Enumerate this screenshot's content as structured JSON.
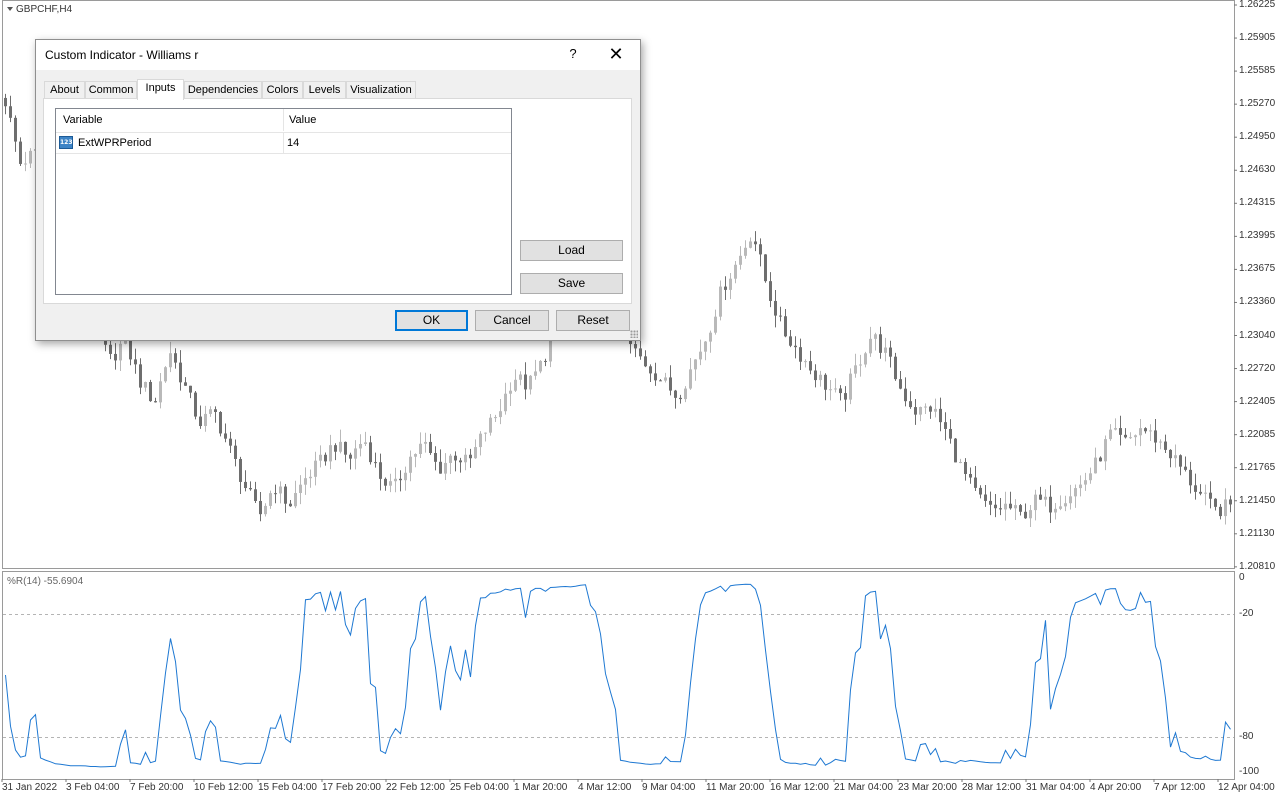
{
  "chart": {
    "symbol": "GBPCHF,H4",
    "indicator_label": "%R(14) -55.6904",
    "price_axis": [
      "1.26225",
      "1.25905",
      "1.25585",
      "1.25270",
      "1.24950",
      "1.24630",
      "1.24315",
      "1.23995",
      "1.23675",
      "1.23360",
      "1.23040",
      "1.22720",
      "1.22405",
      "1.22085",
      "1.21765",
      "1.21450",
      "1.21130",
      "1.20810"
    ],
    "indicator_axis": [
      "0",
      "-20",
      "-80",
      "-100"
    ],
    "time_axis": [
      "31 Jan 2022",
      "3 Feb 04:00",
      "7 Feb 20:00",
      "10 Feb 12:00",
      "15 Feb 04:00",
      "17 Feb 20:00",
      "22 Feb 12:00",
      "25 Feb 04:00",
      "1 Mar 20:00",
      "4 Mar 12:00",
      "9 Mar 04:00",
      "11 Mar 20:00",
      "16 Mar 12:00",
      "21 Mar 04:00",
      "23 Mar 20:00",
      "28 Mar 12:00",
      "31 Mar 04:00",
      "4 Apr 20:00",
      "7 Apr 12:00",
      "12 Apr 04:00"
    ],
    "colors": {
      "bull_candle": "#b9b9b9",
      "bear_candle": "#6e6e6e",
      "indicator_line": "#1e78d2",
      "level_line": "#b4b4b4"
    },
    "price_path": [
      1.253,
      1.247,
      1.248,
      1.244,
      1.2395,
      1.235,
      1.231,
      1.228,
      1.23,
      1.226,
      1.224,
      1.229,
      1.2255,
      1.222,
      1.223,
      1.2195,
      1.216,
      1.213,
      1.216,
      1.214,
      1.2165,
      1.218,
      1.22,
      1.2185,
      1.2205,
      1.217,
      1.2155,
      1.2185,
      1.22,
      1.2175,
      1.219,
      1.218,
      1.221,
      1.223,
      1.2265,
      1.2255,
      1.228,
      1.232,
      1.235,
      1.2385,
      1.234,
      1.2315,
      1.229,
      1.2275,
      1.226,
      1.2245,
      1.2275,
      1.2305,
      1.235,
      1.2375,
      1.2405,
      1.235,
      1.231,
      1.229,
      1.227,
      1.2255,
      1.224,
      1.2275,
      1.2305,
      1.2285,
      1.225,
      1.223,
      1.2235,
      1.221,
      1.2175,
      1.215,
      1.2135,
      1.214,
      1.213,
      1.2145,
      1.214,
      1.215,
      1.216,
      1.218,
      1.221,
      1.22,
      1.2215,
      1.2205,
      1.219,
      1.217,
      1.215,
      1.2135,
      1.214
    ]
  },
  "dialog": {
    "title": "Custom Indicator - Williams r",
    "help": "?",
    "close": "✕",
    "tabs": [
      "About",
      "Common",
      "Inputs",
      "Dependencies",
      "Colors",
      "Levels",
      "Visualization"
    ],
    "active_tab": "Inputs",
    "columns": {
      "variable": "Variable",
      "value": "Value"
    },
    "inputs": [
      {
        "variable": "ExtWPRPeriod",
        "value": "14",
        "type_icon": "123"
      }
    ],
    "buttons": {
      "load": "Load",
      "save": "Save",
      "ok": "OK",
      "cancel": "Cancel",
      "reset": "Reset"
    }
  }
}
